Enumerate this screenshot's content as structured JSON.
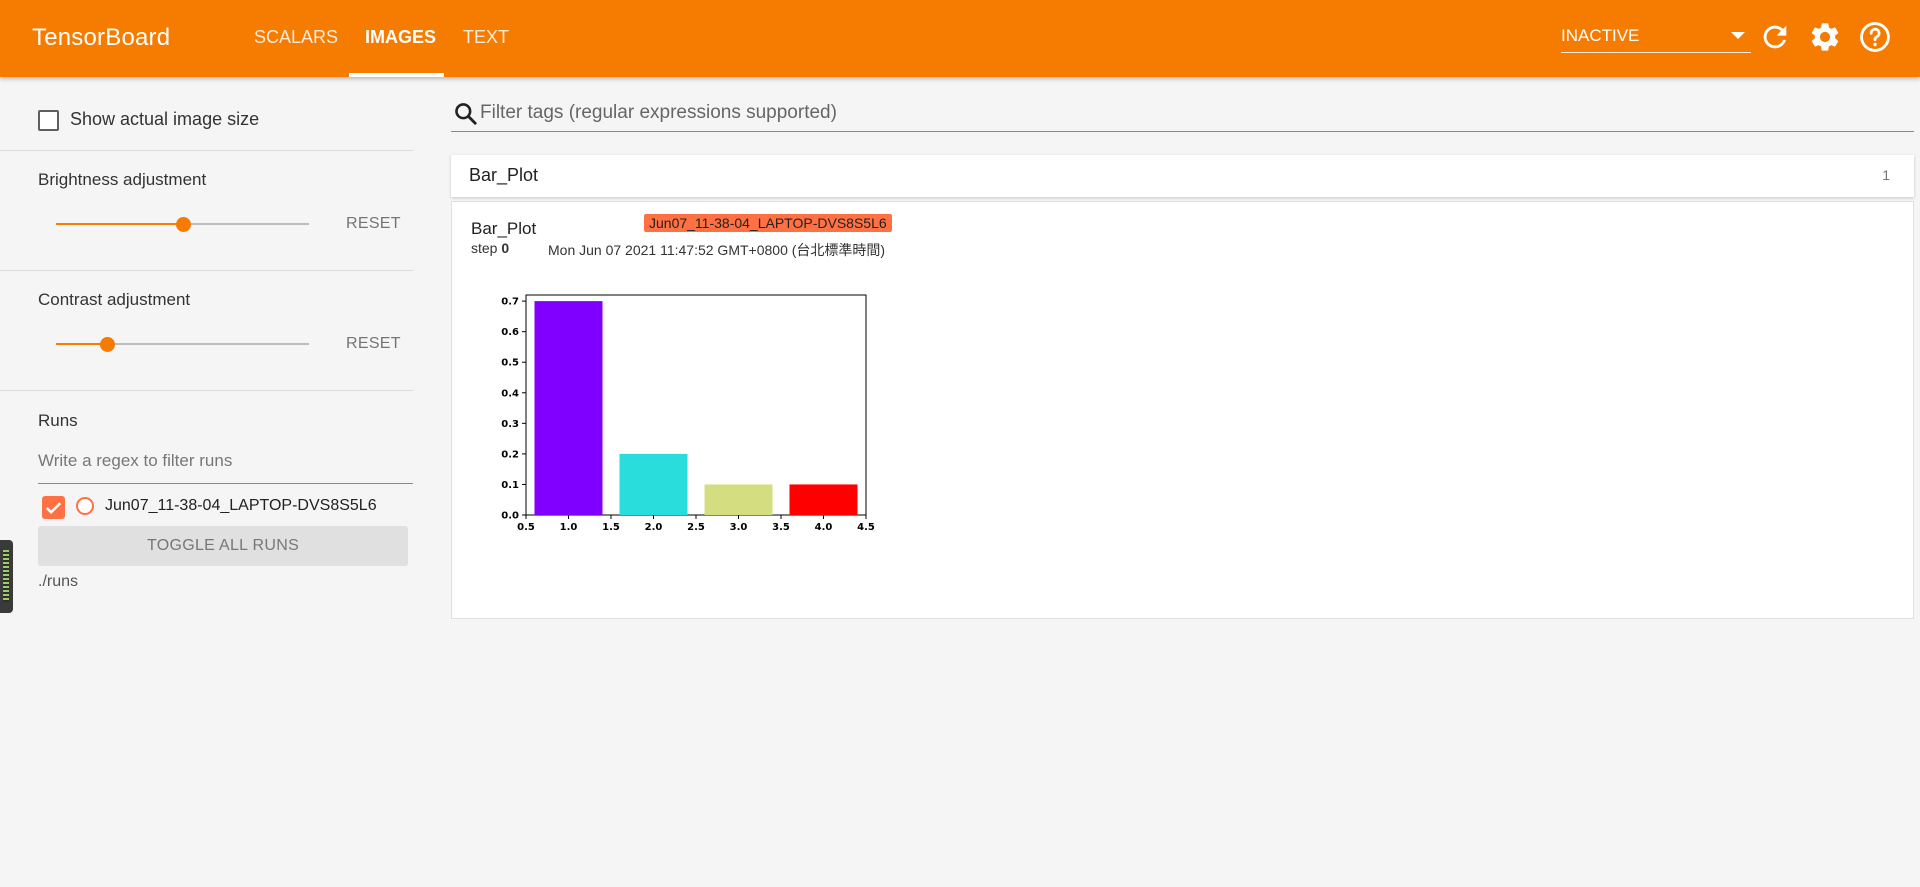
{
  "header": {
    "app_title": "TensorBoard",
    "tabs": [
      {
        "label": "SCALARS",
        "active": false
      },
      {
        "label": "IMAGES",
        "active": true
      },
      {
        "label": "TEXT",
        "active": false
      }
    ],
    "reload_select_value": "INACTIVE",
    "icons": [
      "refresh-icon",
      "settings-icon",
      "help-icon"
    ]
  },
  "sidebar": {
    "show_actual_size_label": "Show actual image size",
    "show_actual_size_checked": false,
    "brightness": {
      "label": "Brightness adjustment",
      "reset_label": "RESET",
      "level": 0.5
    },
    "contrast": {
      "label": "Contrast adjustment",
      "reset_label": "RESET",
      "level": 0.2
    },
    "runs": {
      "title": "Runs",
      "filter_placeholder": "Write a regex to filter runs",
      "items": [
        {
          "name": "Jun07_11-38-04_LAPTOP-DVS8S5L6",
          "checked": true
        }
      ],
      "toggle_all_label": "TOGGLE ALL RUNS",
      "logdir": "./runs"
    }
  },
  "main": {
    "filter_placeholder": "Filter tags (regular expressions supported)",
    "category": {
      "title": "Bar_Plot",
      "count": "1"
    },
    "card": {
      "tag": "Bar_Plot",
      "step_label": "step",
      "step_value": "0",
      "run_chip": "Jun07_11-38-04_LAPTOP-DVS8S5L6",
      "timestamp": "Mon Jun 07 2021 11:47:52 GMT+0800 (台北標準時間)"
    }
  },
  "colors": {
    "toolbar": "#f57c00",
    "accent": "#f57c00",
    "run_color": "#ff7043"
  },
  "chart_data": {
    "type": "bar",
    "x": [
      1.0,
      2.0,
      3.0,
      4.0
    ],
    "values": [
      0.7,
      0.2,
      0.1,
      0.1
    ],
    "bar_colors": [
      "#8000ff",
      "#2adddd",
      "#d4dd80",
      "#ff0000"
    ],
    "xlim": [
      0.5,
      4.5
    ],
    "ylim": [
      0.0,
      0.7
    ],
    "xticks": [
      "0.5",
      "1.0",
      "1.5",
      "2.0",
      "2.5",
      "3.0",
      "3.5",
      "4.0",
      "4.5"
    ],
    "yticks": [
      "0.0",
      "0.1",
      "0.2",
      "0.3",
      "0.4",
      "0.5",
      "0.6",
      "0.7"
    ],
    "title": "",
    "xlabel": "",
    "ylabel": ""
  }
}
